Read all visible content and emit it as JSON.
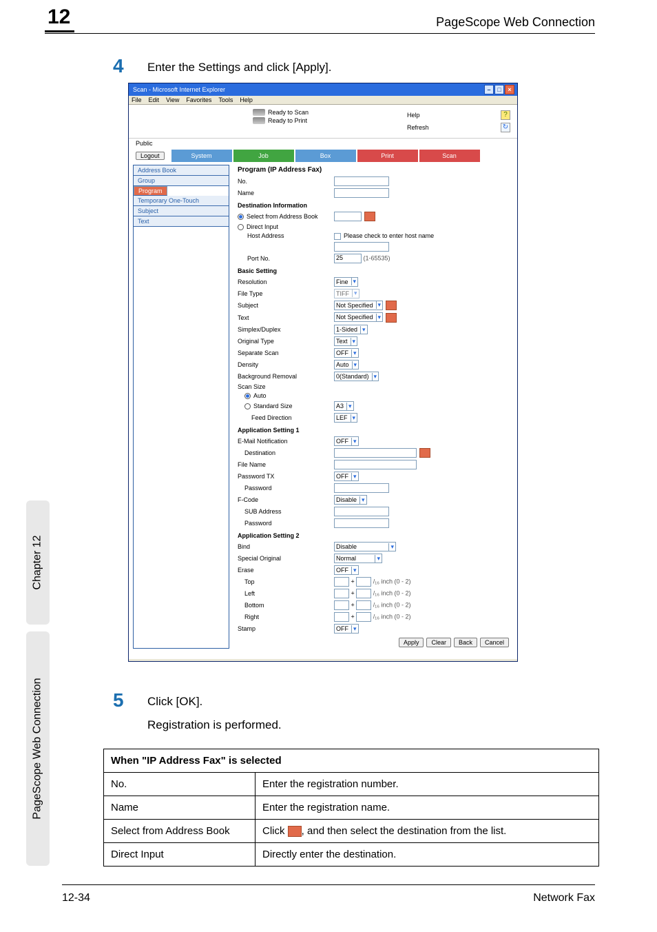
{
  "page": {
    "number": "12",
    "title": "PageScope Web Connection",
    "sidebar_chapter": "Chapter 12",
    "sidebar_title": "PageScope Web Connection",
    "footer_left": "12-34",
    "footer_right": "Network Fax"
  },
  "steps": {
    "s4_num": "4",
    "s4_text": "Enter the Settings and click [Apply].",
    "s5_num": "5",
    "s5_text": "Click [OK].",
    "s5_sub": "Registration is performed."
  },
  "table": {
    "header": "When \"IP Address Fax\" is selected",
    "rows": [
      {
        "k": "No.",
        "v": "Enter the registration number."
      },
      {
        "k": "Name",
        "v": "Enter the registration name."
      },
      {
        "k": "Select from Address Book",
        "v_pre": "Click ",
        "v_post": ", and then select the destination from the list."
      },
      {
        "k": "Direct Input",
        "v": "Directly enter the destination."
      }
    ]
  },
  "browser": {
    "title": "Scan - Microsoft Internet Explorer",
    "menu": [
      "File",
      "Edit",
      "View",
      "Favorites",
      "Tools",
      "Help"
    ],
    "status": {
      "scan": "Ready to Scan",
      "print": "Ready to Print"
    },
    "help": "Help",
    "refresh": "Refresh",
    "public": "Public",
    "logout": "Logout",
    "tabs": [
      "System",
      "Job",
      "Box",
      "Print",
      "Scan"
    ],
    "nav": [
      "Address Book",
      "Group",
      "Program",
      "Temporary One-Touch",
      "Subject",
      "Text"
    ]
  },
  "form": {
    "title": "Program (IP Address Fax)",
    "no": "No.",
    "name": "Name",
    "dest_info": "Destination Information",
    "sel_book": "Select from Address Book",
    "direct": "Direct Input",
    "host": "Host Address",
    "host_chk": "Please check to enter host name",
    "port": "Port No.",
    "port_val": "25",
    "port_range": "(1-65535)",
    "basic": "Basic Setting",
    "resolution": "Resolution",
    "resolution_v": "Fine",
    "filetype": "File Type",
    "filetype_v": "TIFF",
    "subject": "Subject",
    "subject_v": "Not Specified",
    "text": "Text",
    "text_v": "Not Specified",
    "duplex": "Simplex/Duplex",
    "duplex_v": "1-Sided",
    "orig_type": "Original Type",
    "orig_type_v": "Text",
    "sep_scan": "Separate Scan",
    "sep_scan_v": "OFF",
    "density": "Density",
    "density_v": "Auto",
    "bg": "Background Removal",
    "bg_v": "0(Standard)",
    "scan_size": "Scan Size",
    "auto": "Auto",
    "std_size": "Standard Size",
    "std_size_v": "A3",
    "feed": "Feed Direction",
    "feed_v": "LEF",
    "app1": "Application Setting 1",
    "email_notif": "E-Mail Notification",
    "email_notif_v": "OFF",
    "dest": "Destination",
    "file_name": "File Name",
    "pwdtx": "Password TX",
    "pwdtx_v": "OFF",
    "pwd": "Password",
    "fcode": "F-Code",
    "fcode_v": "Disable",
    "sub_addr": "SUB Address",
    "fpwd": "Password",
    "app2": "Application Setting 2",
    "bind": "Bind",
    "bind_v": "Disable",
    "special": "Special Original",
    "special_v": "Normal",
    "erase": "Erase",
    "erase_v": "OFF",
    "top": "Top",
    "left": "Left",
    "bottom": "Bottom",
    "right": "Right",
    "unit": "/₁₆ inch (0 - 2)",
    "stamp": "Stamp",
    "stamp_v": "OFF",
    "btns": {
      "apply": "Apply",
      "clear": "Clear",
      "back": "Back",
      "cancel": "Cancel"
    }
  }
}
